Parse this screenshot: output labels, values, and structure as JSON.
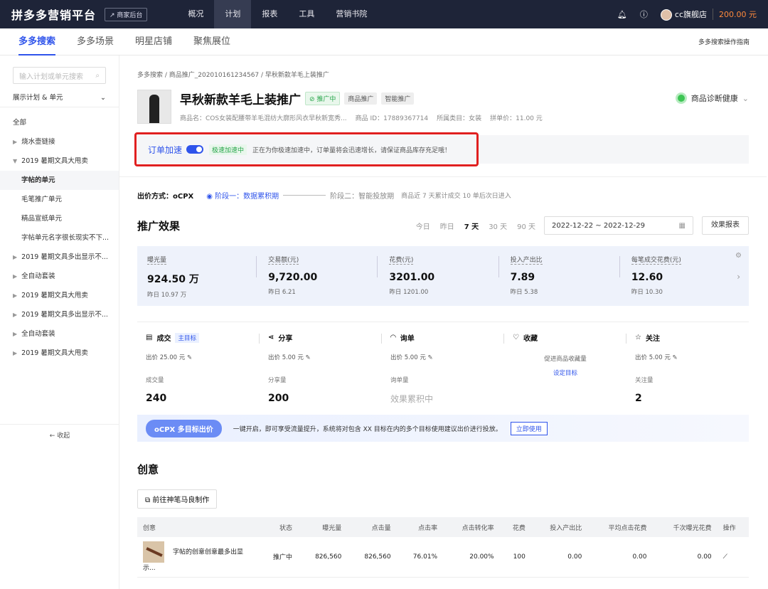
{
  "topbar": {
    "logo": "拼多多营销平台",
    "back": "↗ 商家后台",
    "nav": [
      "概况",
      "计划",
      "报表",
      "工具",
      "营销书院"
    ],
    "store": "cc旗舰店",
    "balance": "200.00 元"
  },
  "subnav": {
    "tabs": [
      "多多搜索",
      "多多场景",
      "明星店铺",
      "聚焦展位"
    ],
    "guide": "多多搜索操作指南"
  },
  "sidebar": {
    "search_placeholder": "输入计划或单元搜索",
    "filter": "展示计划 & 单元",
    "items": [
      "全部",
      "烧水壶链接",
      "2019 暑期文具大甩卖",
      "字帖的单元",
      "毛笔推广单元",
      "精品宣纸单元",
      "字帖单元名字很长现实不下...",
      "2019 暑期文具多出显示不...",
      "全自动套装",
      "2019 暑期文具大甩卖",
      "2019 暑期文具多出显示不...",
      "全自动套装",
      "2019 暑期文具大甩卖"
    ],
    "collapse": "← 收起"
  },
  "crumb": "多多搜索 / 商品推广_202010161234567 / 早秋新款羊毛上装推广",
  "product": {
    "title": "早秋新款羊毛上装推广",
    "tags": [
      "⊘ 推广中",
      "商品推广",
      "智能推广"
    ],
    "meta": [
      "商品名：COS女装配腰带羊毛混纺大廓形风衣早秋新宽秀...",
      "商品 ID：17889367714",
      "所属类目：女装",
      "拼单价：11.00 元"
    ],
    "health": "商品诊断健康"
  },
  "accel": {
    "label": "订单加速",
    "status": "极速加速中",
    "desc": "正在为你极速加速中，订单量将会迅速增长，请保证商品库存充足哦！"
  },
  "bid": {
    "label": "出价方式：oCPX",
    "stage1": "阶段一：数据累积期",
    "stage2": "阶段二：智能投放期",
    "note": "商品近 7 天累计成交 10 单后次日进入"
  },
  "effect": {
    "title": "推广效果",
    "days": [
      "今日",
      "昨日",
      "7 天",
      "30 天",
      "90 天"
    ],
    "range": "2022-12-22 ~ 2022-12-29",
    "report": "效果报表"
  },
  "metrics": [
    {
      "label": "曝光量",
      "value": "924.50 万",
      "yesterday": "昨日 10.97 万"
    },
    {
      "label": "交易额(元)",
      "value": "9,720.00",
      "yesterday": "昨日 6.21"
    },
    {
      "label": "花费(元)",
      "value": "3201.00",
      "yesterday": "昨日 1201.00"
    },
    {
      "label": "投入产出比",
      "value": "7.89",
      "yesterday": "昨日 5.38"
    },
    {
      "label": "每笔成交花费(元)",
      "value": "12.60",
      "yesterday": "昨日 10.30"
    }
  ],
  "goals": [
    {
      "title": "成交",
      "tag": "主目标",
      "bid": "出价  25.00 元",
      "label": "成交量",
      "value": "240"
    },
    {
      "title": "分享",
      "bid": "出价  5.00 元",
      "label": "分享量",
      "value": "200"
    },
    {
      "title": "询单",
      "bid": "出价  5.00 元",
      "label": "询单量",
      "value": "效果累积中"
    },
    {
      "title": "收藏",
      "desc": "促进商品收藏量",
      "link": "设定目标"
    },
    {
      "title": "关注",
      "bid": "出价  5.00 元",
      "label": "关注量",
      "value": "2"
    }
  ],
  "banner": {
    "pill": "oCPX 多目标出价",
    "text": "一键开启，即可享受流量提升，系统将对包含 XX 目标在内的多个目标使用建议出价进行投放。",
    "button": "立即使用"
  },
  "creative": {
    "title": "创意",
    "make": "前往神笔马良制作",
    "columns": [
      "创意",
      "状态",
      "曝光量",
      "点击量",
      "点击率",
      "点击转化率",
      "花费",
      "投入产出比",
      "平均点击花费",
      "千次曝光花费",
      "操作"
    ],
    "rows": [
      [
        "字帖的创意创意最多出显示...",
        "推广中",
        "826,560",
        "826,560",
        "76.01%",
        "20.00%",
        "100",
        "0.00",
        "0.00",
        "0.00"
      ]
    ]
  }
}
